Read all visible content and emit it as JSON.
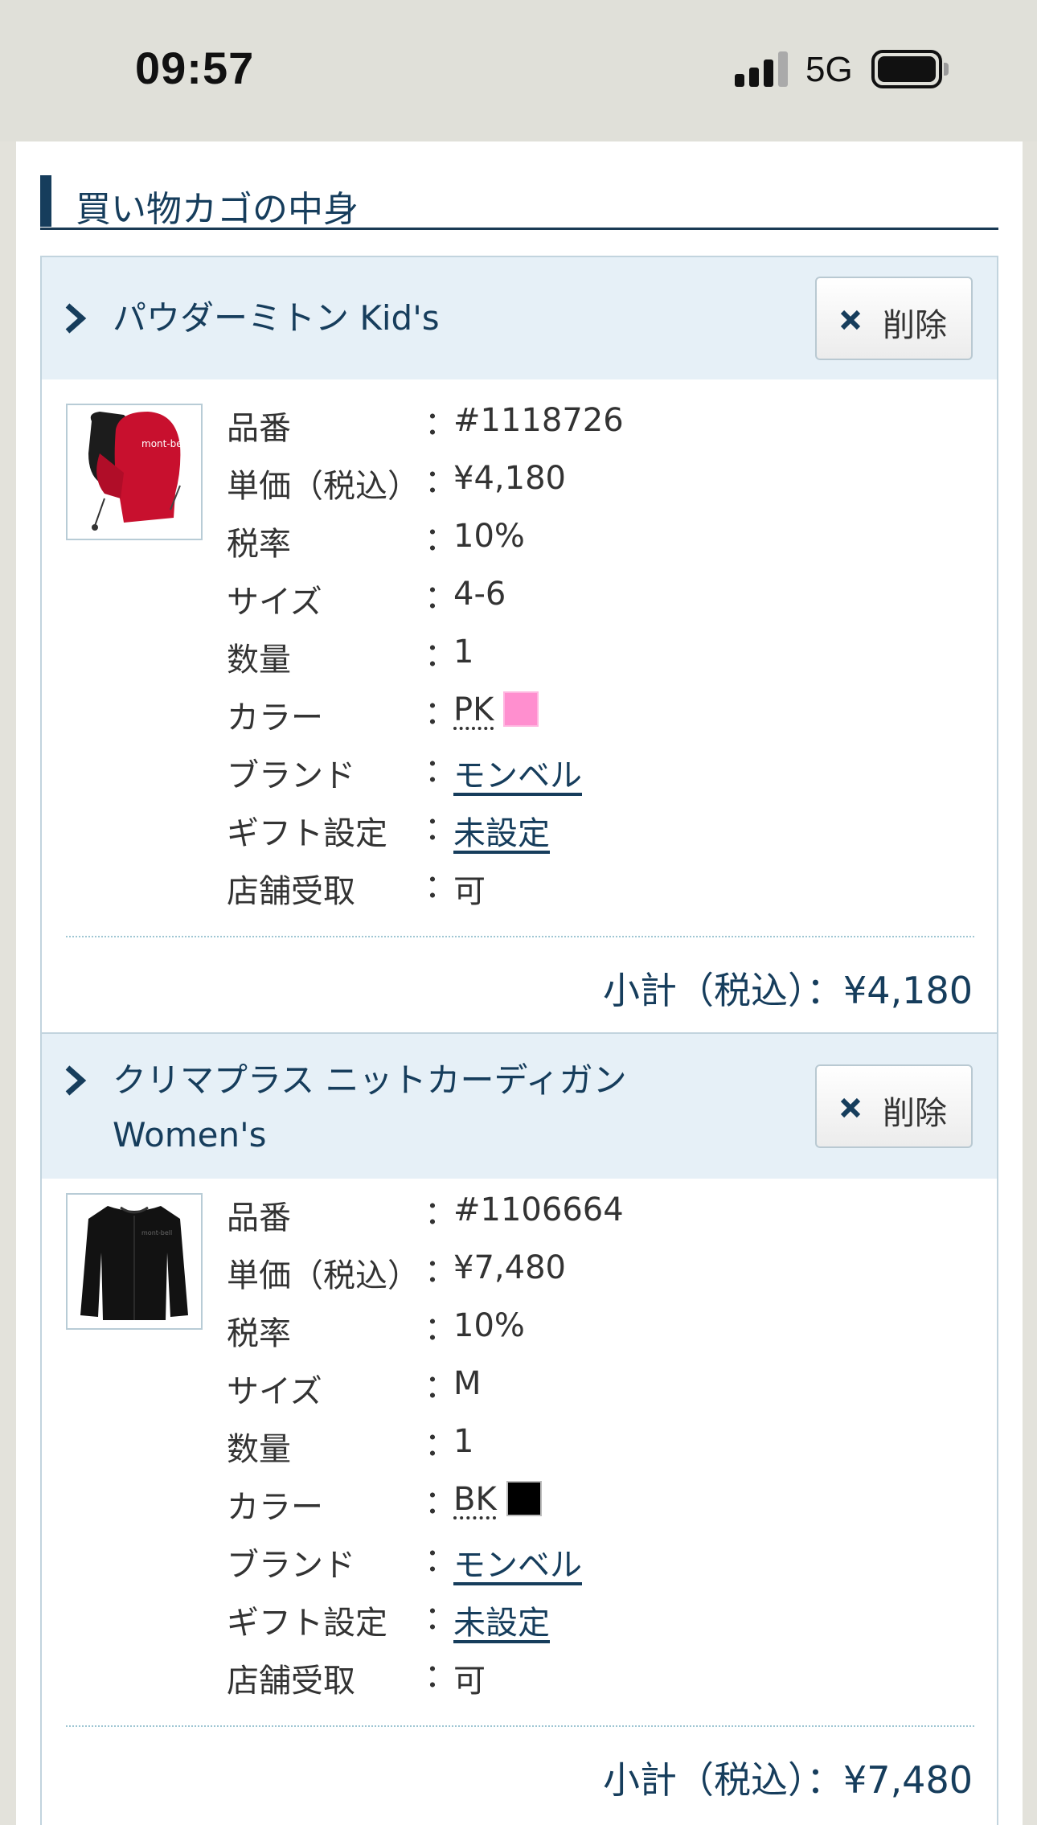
{
  "status_bar": {
    "time": "09:57",
    "network": "5G"
  },
  "cart": {
    "title": "買い物カゴの中身",
    "items": [
      {
        "name": "パウダーミトン Kid's",
        "delete_label": "削除",
        "image_icon": "mitten-product-image",
        "specs": {
          "product_number": {
            "label": "品番",
            "value": "#1118726"
          },
          "unit_price": {
            "label": "単価（税込）",
            "value": "¥4,180"
          },
          "tax_rate": {
            "label": "税率",
            "value": "10%"
          },
          "size": {
            "label": "サイズ",
            "value": "4-6"
          },
          "quantity": {
            "label": "数量",
            "value": "1"
          },
          "color": {
            "label": "カラー",
            "value": "PK",
            "swatch": "#ff8fcf"
          },
          "brand": {
            "label": "ブランド",
            "value": "モンベル"
          },
          "gift": {
            "label": "ギフト設定",
            "value": "未設定"
          },
          "store_pickup": {
            "label": "店舗受取",
            "value": "可"
          }
        },
        "subtotal_label": "小計（税込）",
        "subtotal_value": "：¥4,180"
      },
      {
        "name_line1": "クリマプラス ニットカーディガン",
        "name_line2": "Women's",
        "delete_label": "削除",
        "image_icon": "cardigan-product-image",
        "specs": {
          "product_number": {
            "label": "品番",
            "value": "#1106664"
          },
          "unit_price": {
            "label": "単価（税込）",
            "value": "¥7,480"
          },
          "tax_rate": {
            "label": "税率",
            "value": "10%"
          },
          "size": {
            "label": "サイズ",
            "value": "M"
          },
          "quantity": {
            "label": "数量",
            "value": "1"
          },
          "color": {
            "label": "カラー",
            "value": "BK",
            "swatch": "#000000"
          },
          "brand": {
            "label": "ブランド",
            "value": "モンベル"
          },
          "gift": {
            "label": "ギフト設定",
            "value": "未設定"
          },
          "store_pickup": {
            "label": "店舗受取",
            "value": "可"
          }
        },
        "subtotal_label": "小計（税込）",
        "subtotal_value": "：¥7,480"
      }
    ],
    "separator": "："
  },
  "colors": {
    "accent": "#163d5c",
    "header_bg": "#e6f0f7",
    "border": "#c2d4de"
  }
}
